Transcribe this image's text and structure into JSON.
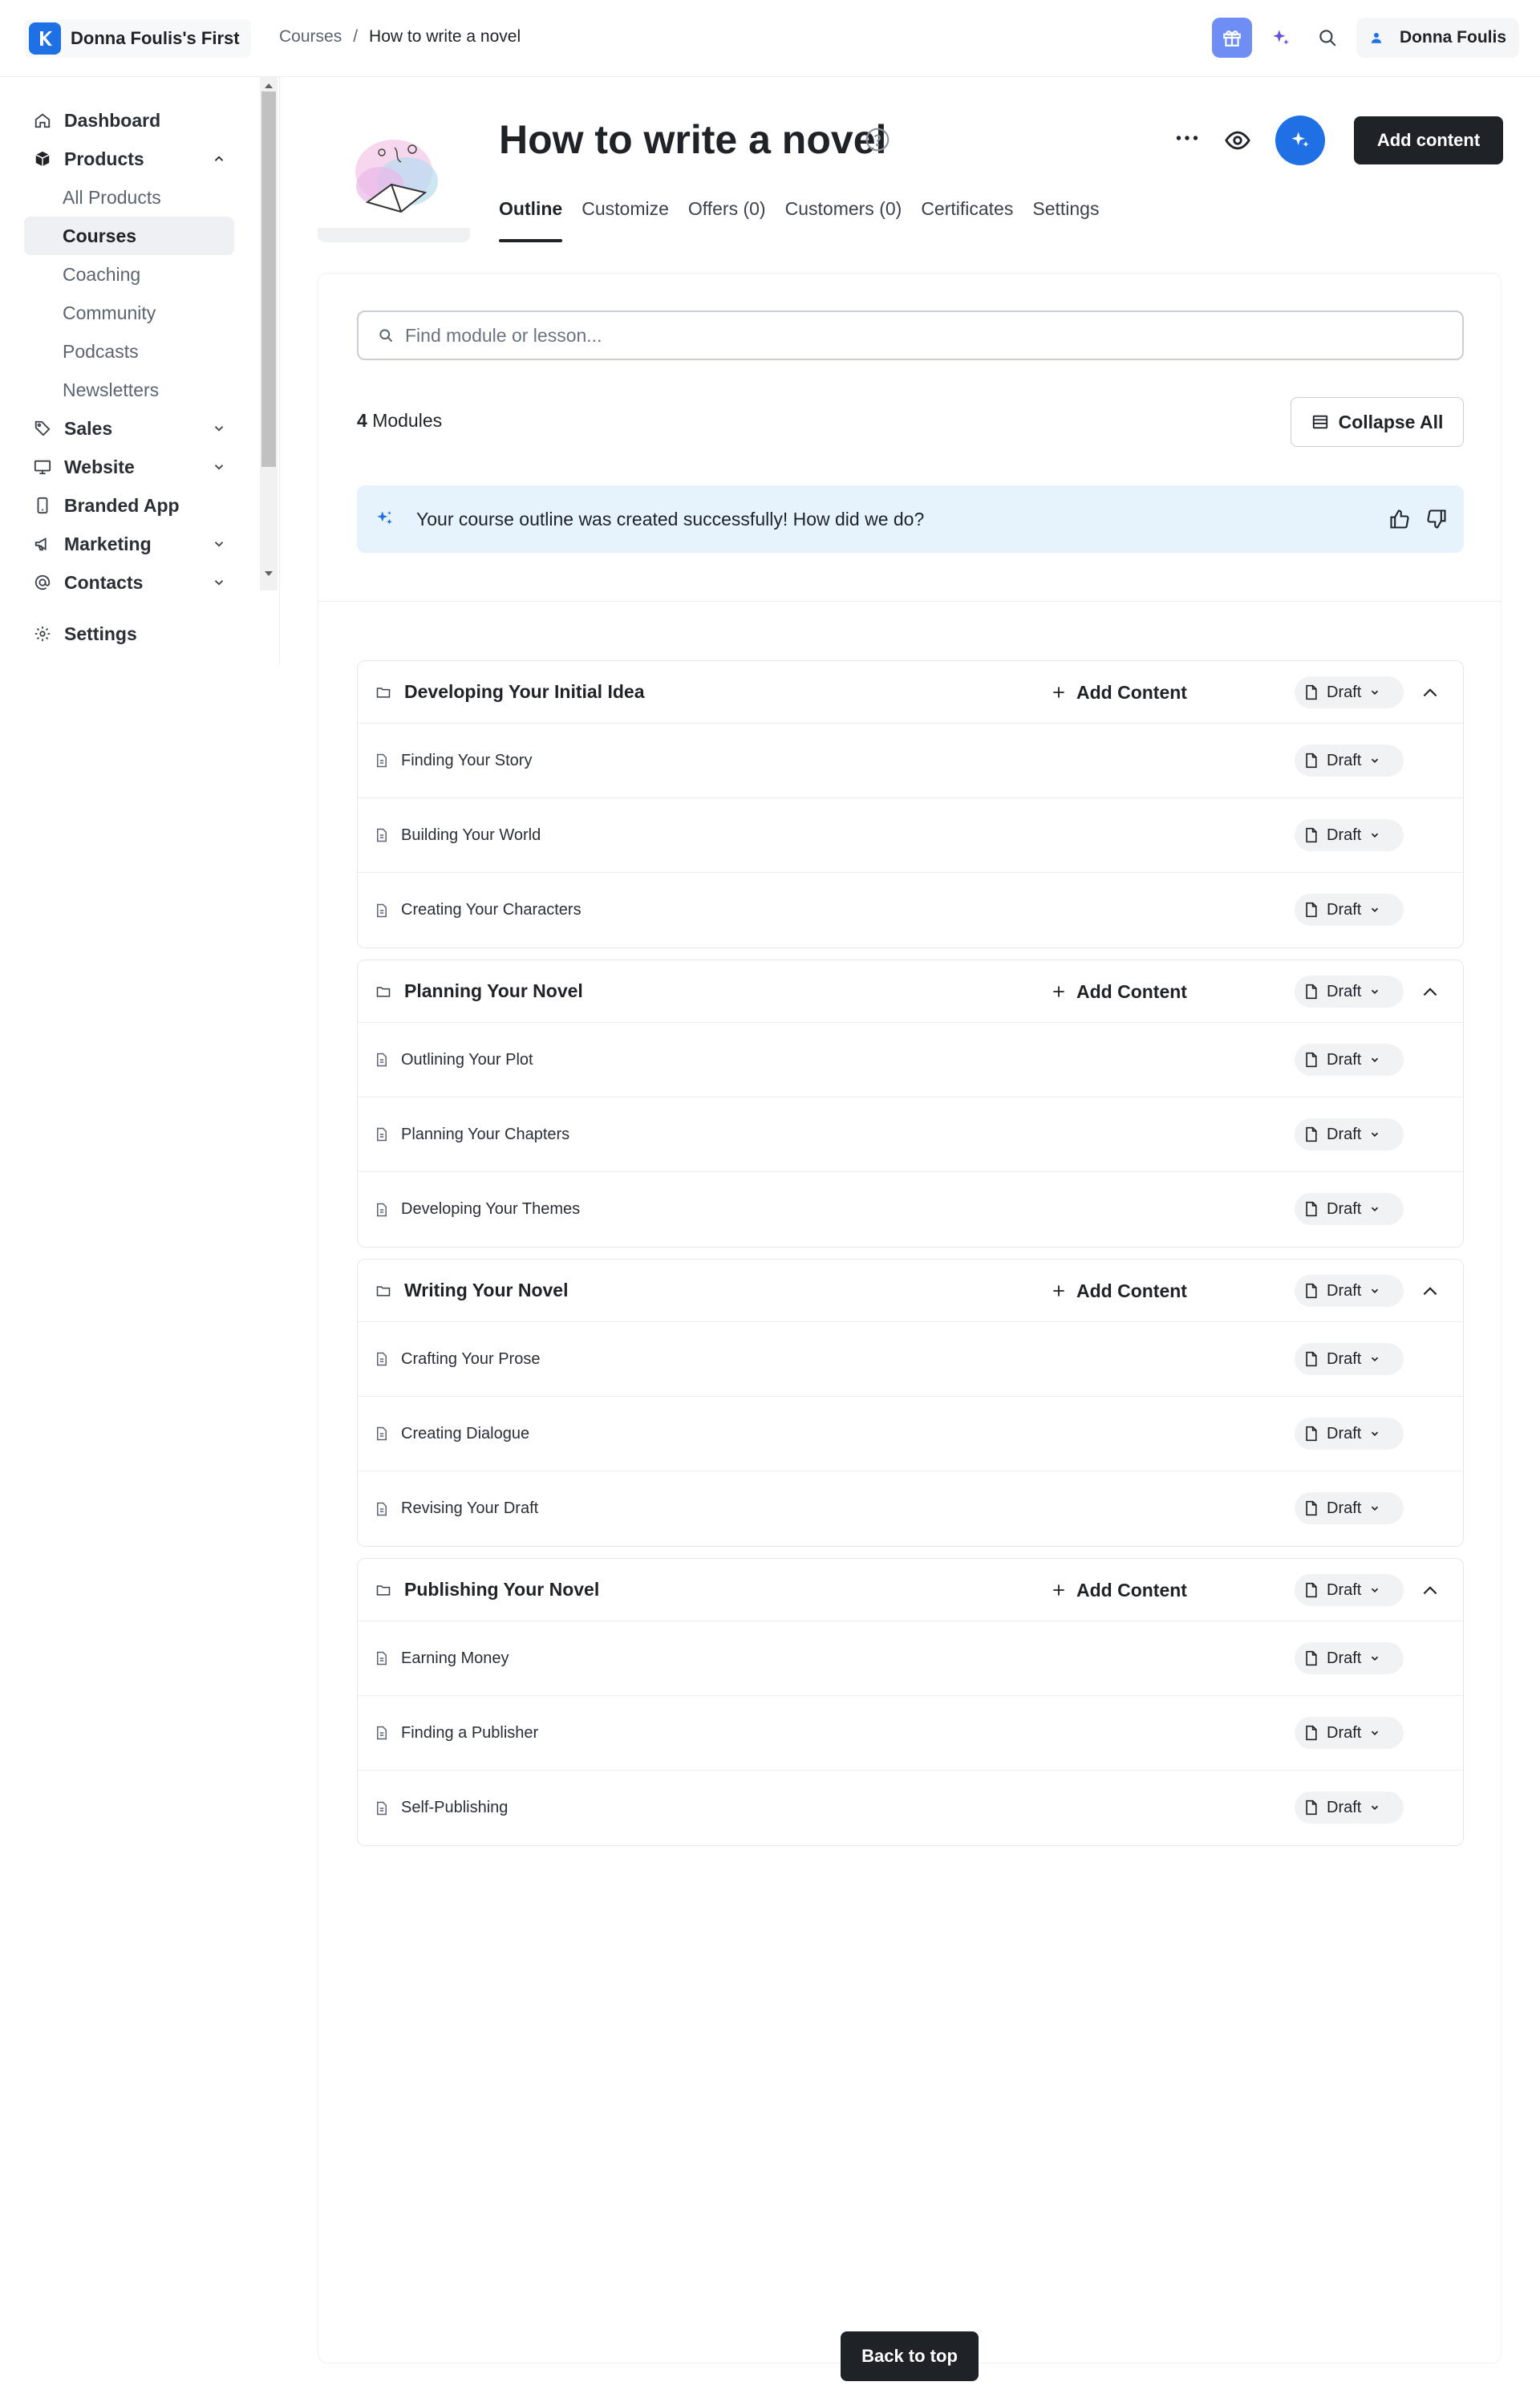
{
  "app": {
    "site_name": "Donna Foulis's First",
    "accent": "#1f6fe5",
    "user_name": "Donna Foulis"
  },
  "breadcrumb": {
    "parent": "Courses",
    "separator": "/",
    "current": "How to write a novel"
  },
  "sidebar": {
    "items": [
      {
        "label": "Dashboard",
        "icon": "home-icon"
      },
      {
        "label": "Products",
        "icon": "box-icon",
        "expanded": true,
        "children": [
          "All Products",
          "Courses",
          "Coaching",
          "Community",
          "Podcasts",
          "Newsletters"
        ],
        "active_child": "Courses"
      },
      {
        "label": "Sales",
        "icon": "tag-icon"
      },
      {
        "label": "Website",
        "icon": "monitor-icon"
      },
      {
        "label": "Branded App",
        "icon": "phone-icon"
      },
      {
        "label": "Marketing",
        "icon": "megaphone-icon"
      },
      {
        "label": "Contacts",
        "icon": "at-icon"
      }
    ],
    "settings_label": "Settings"
  },
  "course": {
    "title": "How to write a novel",
    "tabs": [
      "Outline",
      "Customize",
      "Offers (0)",
      "Customers (0)",
      "Certificates",
      "Settings"
    ],
    "active_tab": "Outline",
    "add_content_label": "Add content"
  },
  "outline": {
    "search_placeholder": "Find module or lesson...",
    "module_count": "4",
    "module_count_label": "Modules",
    "collapse_all_label": "Collapse All",
    "banner_text": "Your course outline was created successfully! How did we do?",
    "add_content_label": "Add Content",
    "status_label": "Draft",
    "modules": [
      {
        "title": "Developing Your Initial Idea",
        "lessons": [
          "Finding Your Story",
          "Building Your World",
          "Creating Your Characters"
        ]
      },
      {
        "title": "Planning Your Novel",
        "lessons": [
          "Outlining Your Plot",
          "Planning Your Chapters",
          "Developing Your Themes"
        ]
      },
      {
        "title": "Writing Your Novel",
        "lessons": [
          "Crafting Your Prose",
          "Creating Dialogue",
          "Revising Your Draft"
        ]
      },
      {
        "title": "Publishing Your Novel",
        "lessons": [
          "Earning Money",
          "Finding a Publisher",
          "Self-Publishing"
        ]
      }
    ]
  },
  "back_to_top_label": "Back to top"
}
